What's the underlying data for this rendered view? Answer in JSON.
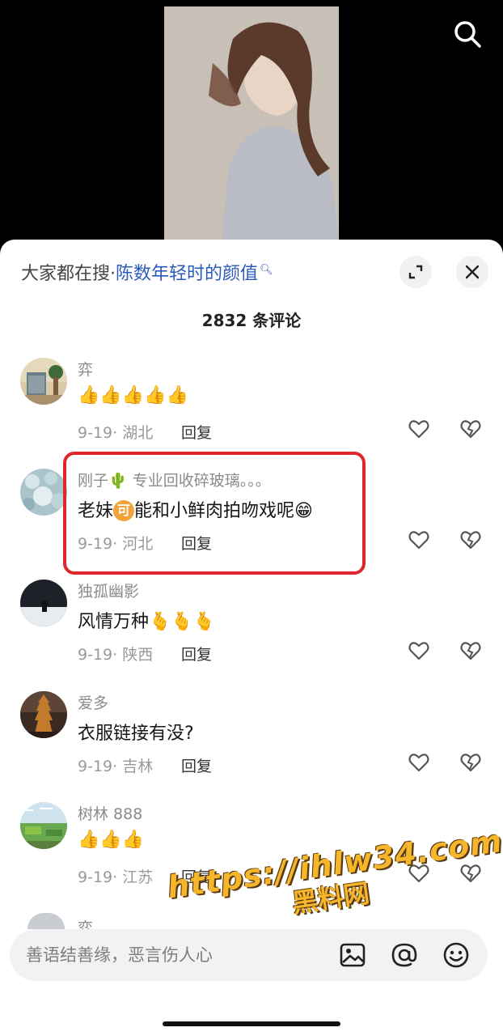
{
  "header": {
    "prefix": "大家都在搜·",
    "keyword": "陈数年轻时的颜值",
    "keyword_icon": "search-icon"
  },
  "comments_count": "2832 条评论",
  "comments": [
    {
      "user": "弈",
      "text": "👍👍👍👍👍",
      "date": "9-19",
      "region": "湖北",
      "reply": "回复"
    },
    {
      "user": "刚子🌵 专业回收碎玻璃。。。",
      "text_before": "老妹",
      "badge": "可",
      "text_after": "能和小鲜肉拍吻戏呢😁",
      "date": "9-19",
      "region": "河北",
      "reply": "回复"
    },
    {
      "user": "独孤幽影",
      "text": "风情万种🫰🫰🫰",
      "date": "9-19",
      "region": "陕西",
      "reply": "回复"
    },
    {
      "user": "爱多",
      "text": "衣服链接有没?",
      "date": "9-19",
      "region": "吉林",
      "reply": "回复"
    },
    {
      "user": "树林 888",
      "text": "👍👍👍",
      "date": "9-19",
      "region": "江苏",
      "reply": "回复"
    }
  ],
  "partial_user": "弈",
  "input": {
    "placeholder": "善语结善缘，恶言伤人心"
  },
  "watermark": {
    "url": "https://ihlw34.com",
    "name": "黑料网"
  },
  "colors": {
    "highlight": "#e0262d",
    "keyword": "#2a5bb8",
    "watermark": "#f6b62b"
  }
}
